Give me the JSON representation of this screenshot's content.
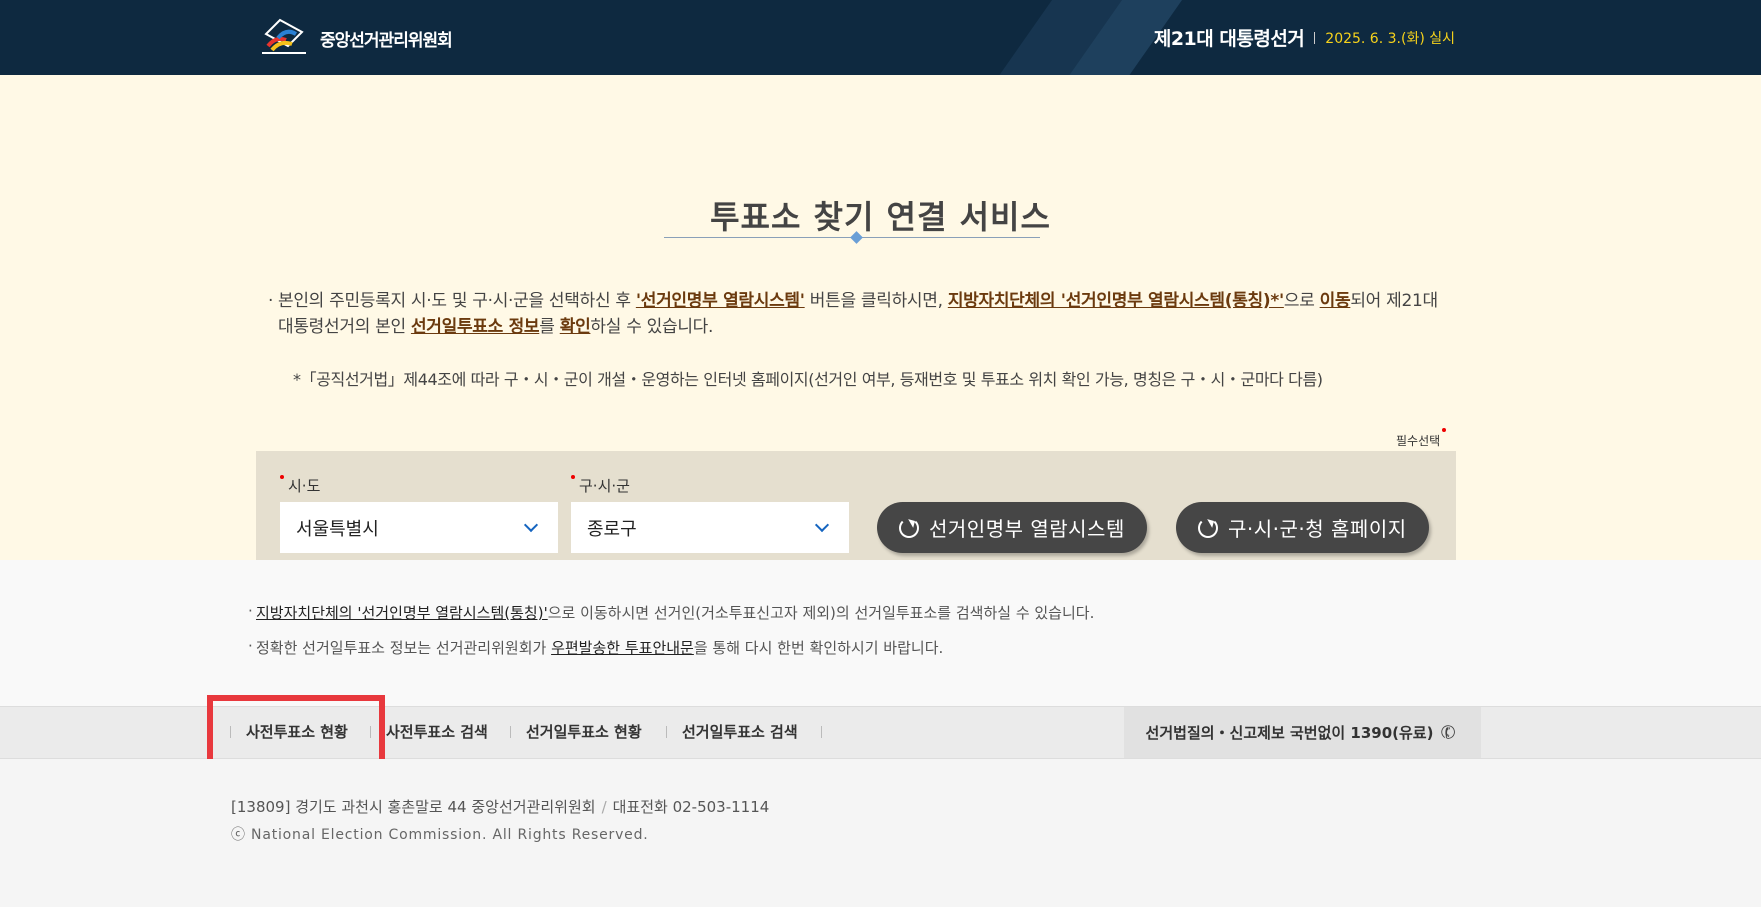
{
  "header": {
    "logo_text": "중앙선거관리위원회",
    "election_title": "제21대 대통령선거",
    "election_date": "2025. 6. 3.(화) 실시"
  },
  "main": {
    "title": "투표소 찾기 연결 서비스",
    "desc": {
      "part1": "본인의 주민등록지 시·도 및 구·시·군을 선택하신 후 ",
      "hl1": "'선거인명부 열람시스템'",
      "part2": " 버튼을 클릭하시면, ",
      "hl2": "지방자치단체의 '선거인명부 열람시스템(통칭)*'",
      "part3": "으로 ",
      "hl3": "이동",
      "part4": "되어 제21대 대통령선거의 본인 ",
      "hl4": "선거일투표소 정보",
      "part5": "를 ",
      "hl5": "확인",
      "part6": "하실 수 있습니다."
    },
    "note": "*「공직선거법」제44조에 따라 구・시・군이 개설・운영하는 인터넷 홈페이지(선거인 여부, 등재번호 및 투표소 위치 확인 가능, 명칭은 구・시・군마다 다름)",
    "required_note": "필수선택",
    "sido_label": "시·도",
    "sido_value": "서울특별시",
    "gusigun_label": "구·시·군",
    "gusigun_value": "종로구",
    "btn_registry": "선거인명부 열람시스템",
    "btn_homepage": "구·시·군·청 홈페이지"
  },
  "info": {
    "line1_link": "지방자치단체의 '선거인명부 열람시스템(통칭)'",
    "line1_rest": "으로 이동하시면 선거인(거소투표신고자 제외)의 선거일투표소를 검색하실 수 있습니다.",
    "line2_pre": "정확한 선거일투표소 정보는 선거관리위원회가 ",
    "line2_link": "우편발송한 투표안내문",
    "line2_post": "을 통해 다시 한번 확인하시기 바랍니다."
  },
  "footer_nav": {
    "items": [
      "사전투표소 현황",
      "사전투표소 검색",
      "선거일투표소 현황",
      "선거일투표소 검색"
    ],
    "hotline": "선거법질의・신고제보 국번없이 1390(유료)"
  },
  "footer": {
    "address": "[13809] 경기도 과천시 홍촌말로 44 중앙선거관리위원회",
    "phone": "대표전화 02-503-1114",
    "copyright": "ⓒ National Election Commission. All Rights Reserved."
  },
  "colors": {
    "header_bg": "#0e2940",
    "date_accent": "#f6d21b",
    "hero_bg": "#fff9e6",
    "highlight_link": "#6b3a0e",
    "button_bg": "#464646",
    "annotation_box": "#e8383d"
  },
  "icons": [
    "logo-ballot-icon",
    "chevron-down-icon",
    "refresh-icon",
    "phone-icon"
  ]
}
